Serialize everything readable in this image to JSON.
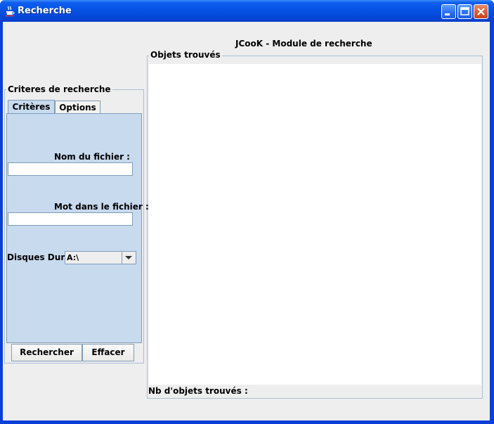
{
  "window": {
    "title": "Recherche",
    "icon": "java-cup-icon",
    "controls": [
      "minimize",
      "maximize",
      "close"
    ]
  },
  "main": {
    "heading": "JCooK - Module de recherche"
  },
  "criteria_panel": {
    "title": "Criteres de recherche",
    "tabs": [
      {
        "label": "Critères",
        "active": true
      },
      {
        "label": "Options",
        "active": false
      }
    ],
    "filename_label": "Nom du fichier :",
    "filename_value": "",
    "word_label": "Mot dans le fichier :",
    "word_value": "",
    "drives_label": "Disques Durs :",
    "drives_selected": "A:\\"
  },
  "buttons": {
    "search": "Rechercher",
    "clear": "Effacer"
  },
  "results_panel": {
    "title": "Objets trouvés",
    "count_label": "Nb d'objets trouvés :"
  },
  "colors": {
    "titlebar": "#0553e4",
    "tab_panel": "#c8daee",
    "window_bg": "#eeeeee"
  }
}
